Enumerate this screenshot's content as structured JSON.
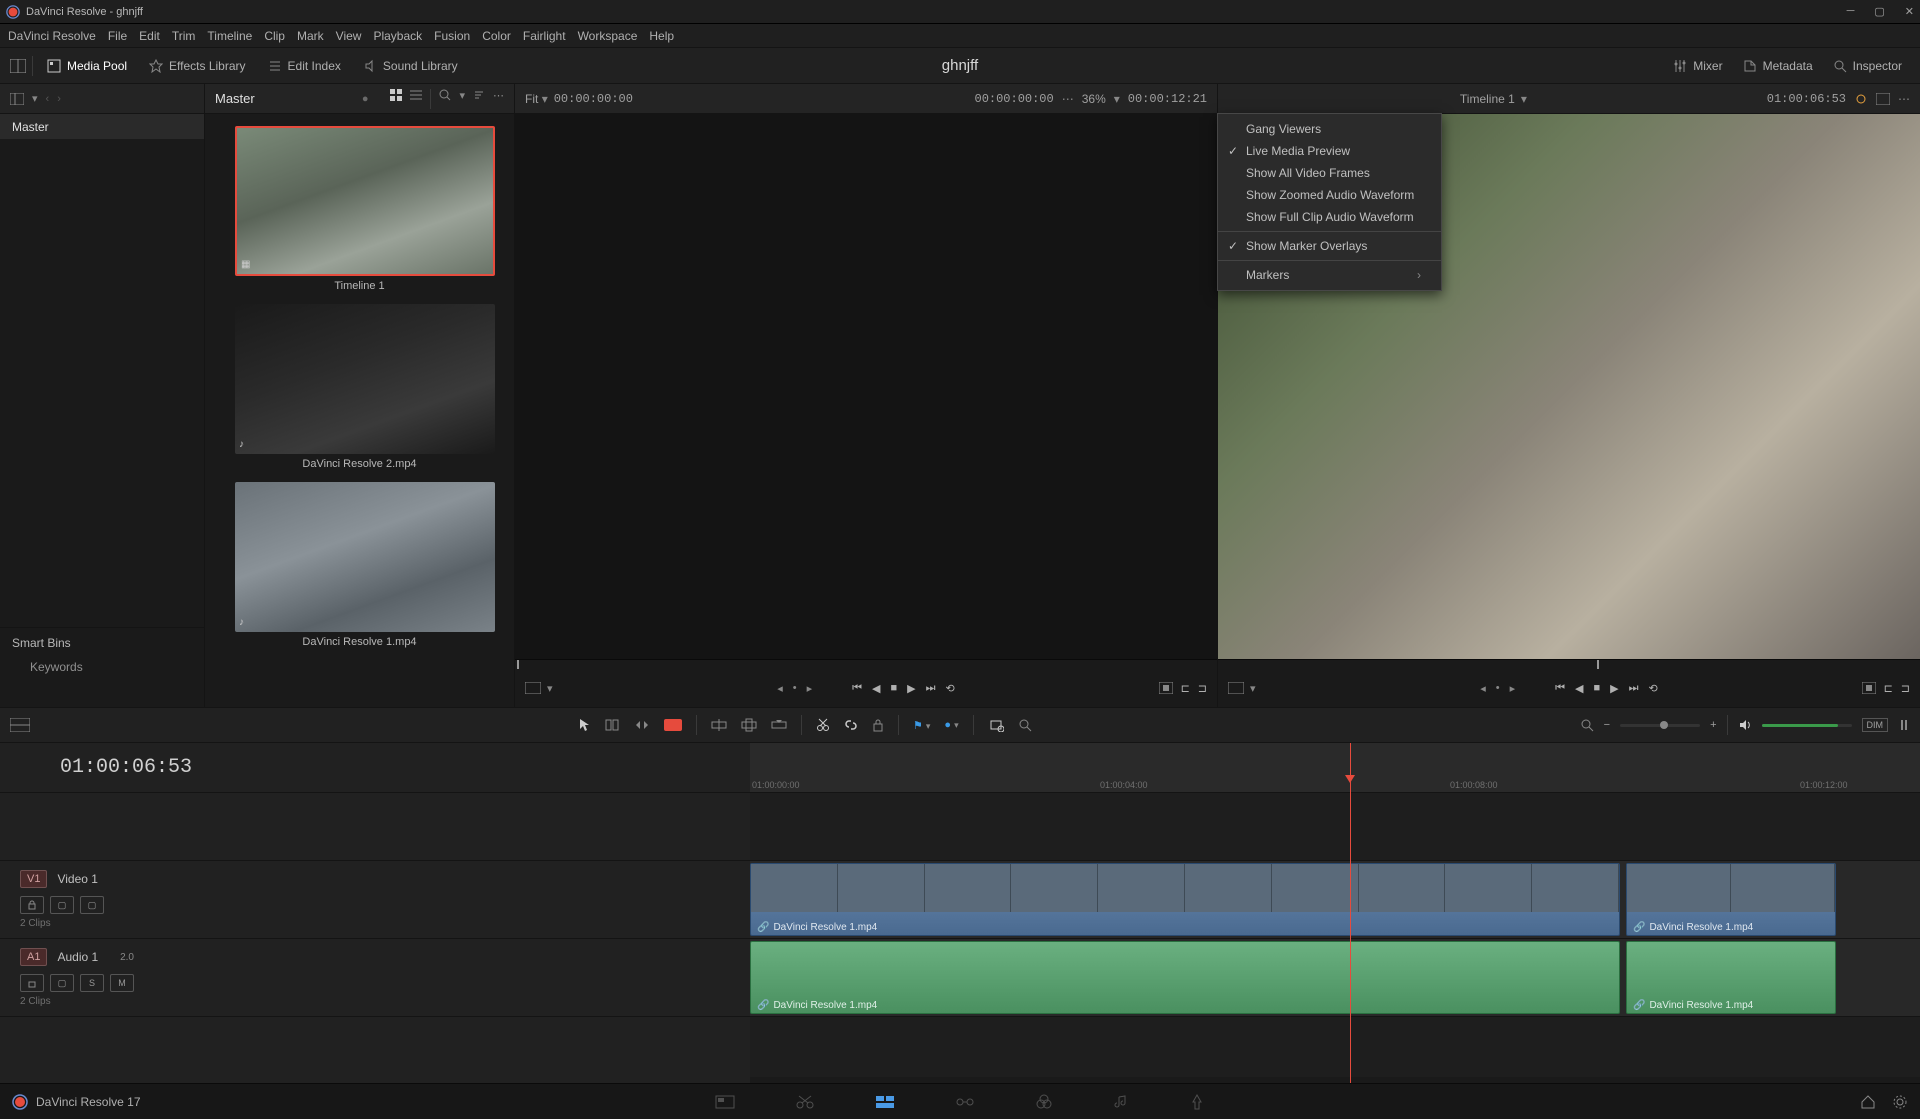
{
  "window_title": "DaVinci Resolve - ghnjff",
  "menubar": [
    "DaVinci Resolve",
    "File",
    "Edit",
    "Trim",
    "Timeline",
    "Clip",
    "Mark",
    "View",
    "Playback",
    "Fusion",
    "Color",
    "Fairlight",
    "Workspace",
    "Help"
  ],
  "toolbar": {
    "media_pool": "Media Pool",
    "effects_library": "Effects Library",
    "edit_index": "Edit Index",
    "sound_library": "Sound Library",
    "mixer": "Mixer",
    "metadata": "Metadata",
    "inspector": "Inspector"
  },
  "project_title": "ghnjff",
  "media_pool_panel": {
    "master": "Master",
    "smart_bins": "Smart Bins",
    "keywords": "Keywords"
  },
  "thumb_panel": {
    "master": "Master",
    "clips": [
      {
        "name": "Timeline 1",
        "selected": true
      },
      {
        "name": "DaVinci Resolve 2.mp4",
        "selected": false
      },
      {
        "name": "DaVinci Resolve 1.mp4",
        "selected": false
      }
    ]
  },
  "source_viewer": {
    "fit": "Fit",
    "tc_left": "00:00:00:00",
    "tc_right": "00:00:00:00",
    "zoom": "36%",
    "duration": "00:00:12:21"
  },
  "timeline_viewer": {
    "name": "Timeline 1",
    "tc": "01:00:06:53"
  },
  "context_menu": {
    "items": [
      {
        "label": "Gang Viewers",
        "checked": false,
        "submenu": false
      },
      {
        "label": "Live Media Preview",
        "checked": true,
        "submenu": false
      },
      {
        "label": "Show All Video Frames",
        "checked": false,
        "submenu": false
      },
      {
        "label": "Show Zoomed Audio Waveform",
        "checked": false,
        "submenu": false
      },
      {
        "label": "Show Full Clip Audio Waveform",
        "checked": false,
        "submenu": false
      }
    ],
    "items2": [
      {
        "label": "Show Marker Overlays",
        "checked": true,
        "submenu": false
      }
    ],
    "items3": [
      {
        "label": "Markers",
        "checked": false,
        "submenu": true
      }
    ]
  },
  "timeline": {
    "timecode": "01:00:06:53",
    "video_track": {
      "badge": "V1",
      "name": "Video 1",
      "clip_count": "2 Clips"
    },
    "audio_track": {
      "badge": "A1",
      "name": "Audio 1",
      "channels": "2.0",
      "clip_count": "2 Clips"
    },
    "clip1_name": "DaVinci Resolve 1.mp4",
    "clip2_name": "DaVinci Resolve 1.mp4",
    "ruler_ticks": [
      "01:00:00:00",
      "01:00:04:00",
      "01:00:08:00",
      "01:00:12:00"
    ]
  },
  "footer": {
    "version": "DaVinci Resolve 17"
  },
  "dim_label": "DIM"
}
